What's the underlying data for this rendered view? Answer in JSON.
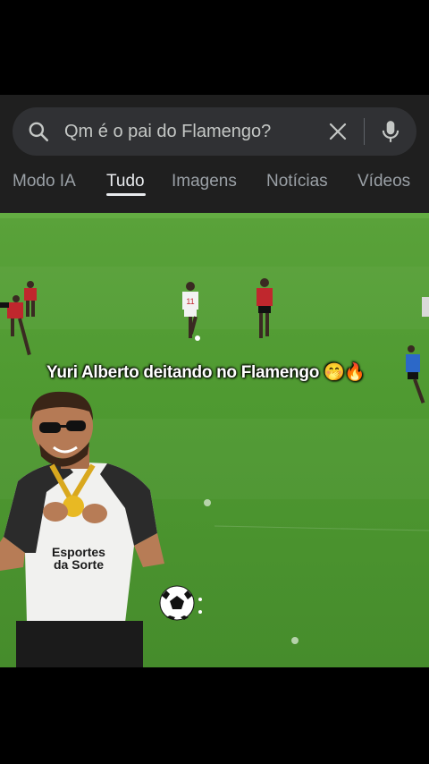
{
  "search": {
    "query": "Qm é o pai do Flamengo?"
  },
  "tabs": [
    {
      "label": "Modo IA"
    },
    {
      "label": "Tudo"
    },
    {
      "label": "Imagens"
    },
    {
      "label": "Notícias"
    },
    {
      "label": "Vídeos"
    }
  ],
  "video": {
    "caption": "Yuri Alberto deitando no Flamengo 🤭🔥"
  },
  "colors": {
    "panel": "#1f1f1f",
    "search_bar": "#303134",
    "pitch": "#4f9a31"
  }
}
